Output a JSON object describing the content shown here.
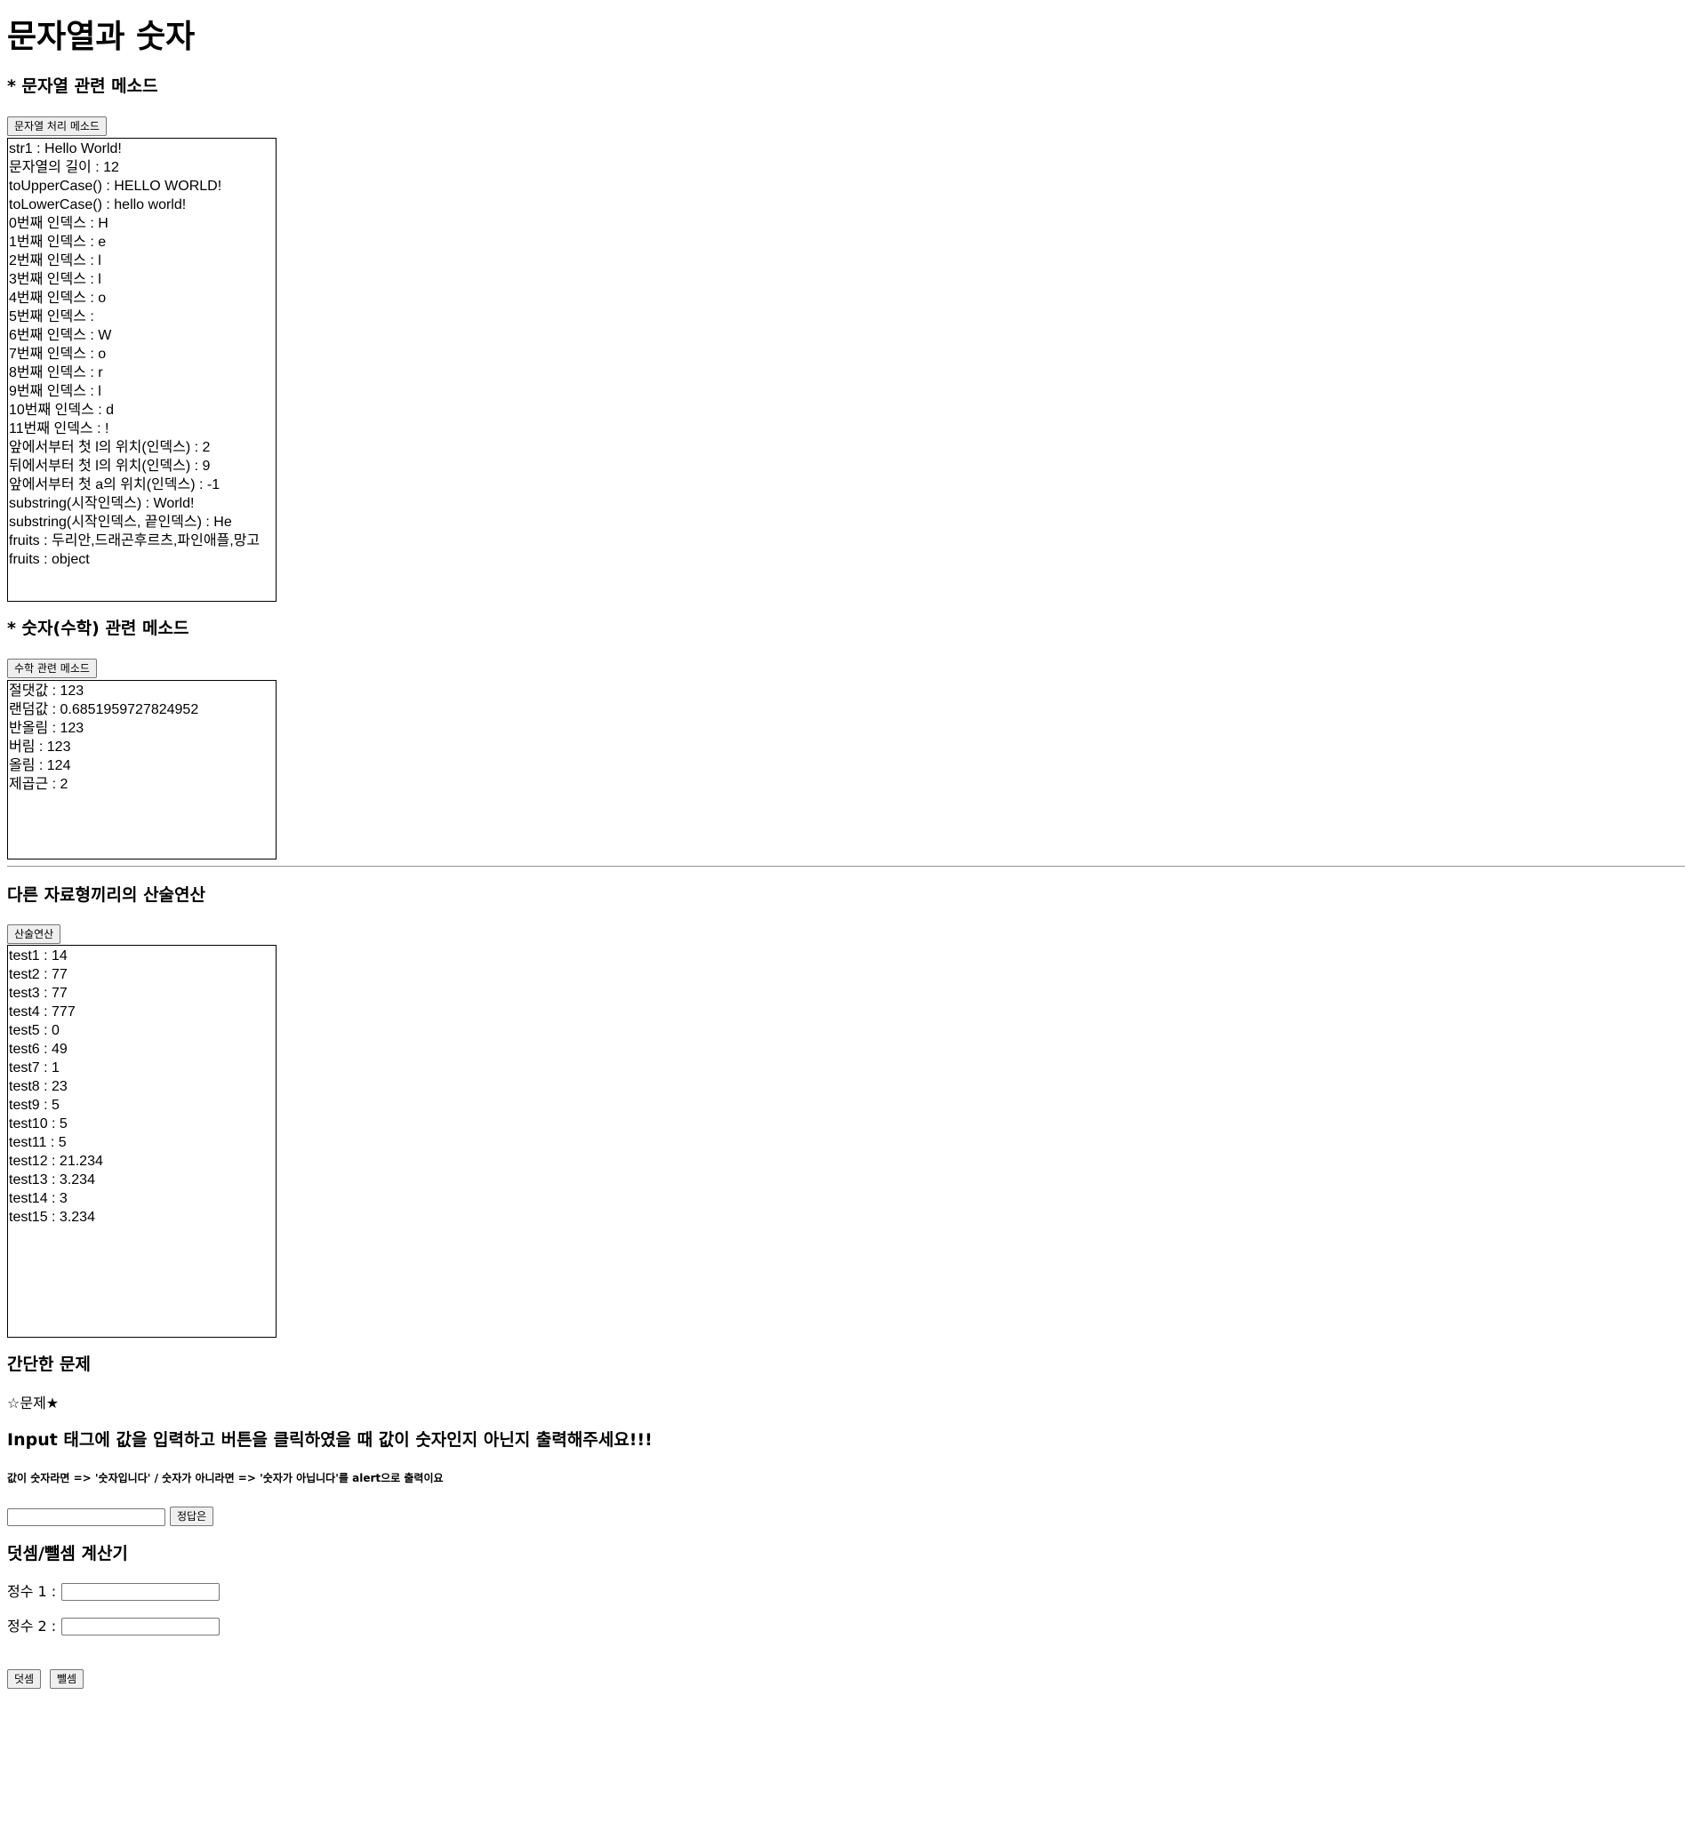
{
  "page_title": "문자열과 숫자",
  "string_section": {
    "heading": "* 문자열 관련 메소드",
    "button_label": "문자열 처리 메소드",
    "output_lines": [
      "str1 : Hello World!",
      "문자열의 길이 : 12",
      "toUpperCase() : HELLO WORLD!",
      "toLowerCase() : hello world!",
      "0번째 인덱스 : H",
      "1번째 인덱스 : e",
      "2번째 인덱스 : l",
      "3번째 인덱스 : l",
      "4번째 인덱스 : o",
      "5번째 인덱스 :",
      "6번째 인덱스 : W",
      "7번째 인덱스 : o",
      "8번째 인덱스 : r",
      "9번째 인덱스 : l",
      "10번째 인덱스 : d",
      "11번째 인덱스 : !",
      "앞에서부터 첫 l의 위치(인덱스) : 2",
      "뒤에서부터 첫 l의 위치(인덱스) : 9",
      "앞에서부터 첫 a의 위치(인덱스) : -1",
      "substring(시작인덱스) : World!",
      "substring(시작인덱스, 끝인덱스) : He",
      "fruits : 두리안,드래곤후르츠,파인애플,망고",
      "fruits : object"
    ]
  },
  "math_section": {
    "heading": "* 숫자(수학) 관련 메소드",
    "button_label": "수학 관련 메소드",
    "output_lines": [
      "절댓값 : 123",
      "랜덤값 : 0.6851959727824952",
      "반올림 : 123",
      "버림 : 123",
      "올림 : 124",
      "제곱근 : 2"
    ]
  },
  "arith_section": {
    "heading": "다른 자료형끼리의 산술연산",
    "button_label": "산술연산",
    "output_lines": [
      "test1 : 14",
      "test2 : 77",
      "test3 : 77",
      "test4 : 777",
      "test5 : 0",
      "test6 : 49",
      "test7 : 1",
      "test8 : 23",
      "test9 : 5",
      "test10 : 5",
      "test11 : 5",
      "test12 : 21.234",
      "test13 : 3.234",
      "test14 : 3",
      "test15 : 3.234"
    ]
  },
  "quiz_section": {
    "heading": "간단한 문제",
    "subtitle": "☆문제★",
    "question": "Input 태그에 값을 입력하고 버튼을 클릭하였을 때 값이 숫자인지 아닌지 출력해주세요!!!",
    "hint": "값이 숫자라면 => '숫자입니다' / 숫자가 아니라면 => '숫자가 아닙니다'를 alert으로 출력이요",
    "input_value": "",
    "button_label": "정답은"
  },
  "calc_section": {
    "heading": "덧셈/뺄셈 계산기",
    "label1": "정수 1 :",
    "label2": "정수 2 :",
    "input1_value": "",
    "input2_value": "",
    "add_label": "덧셈",
    "sub_label": "뺄셈"
  }
}
